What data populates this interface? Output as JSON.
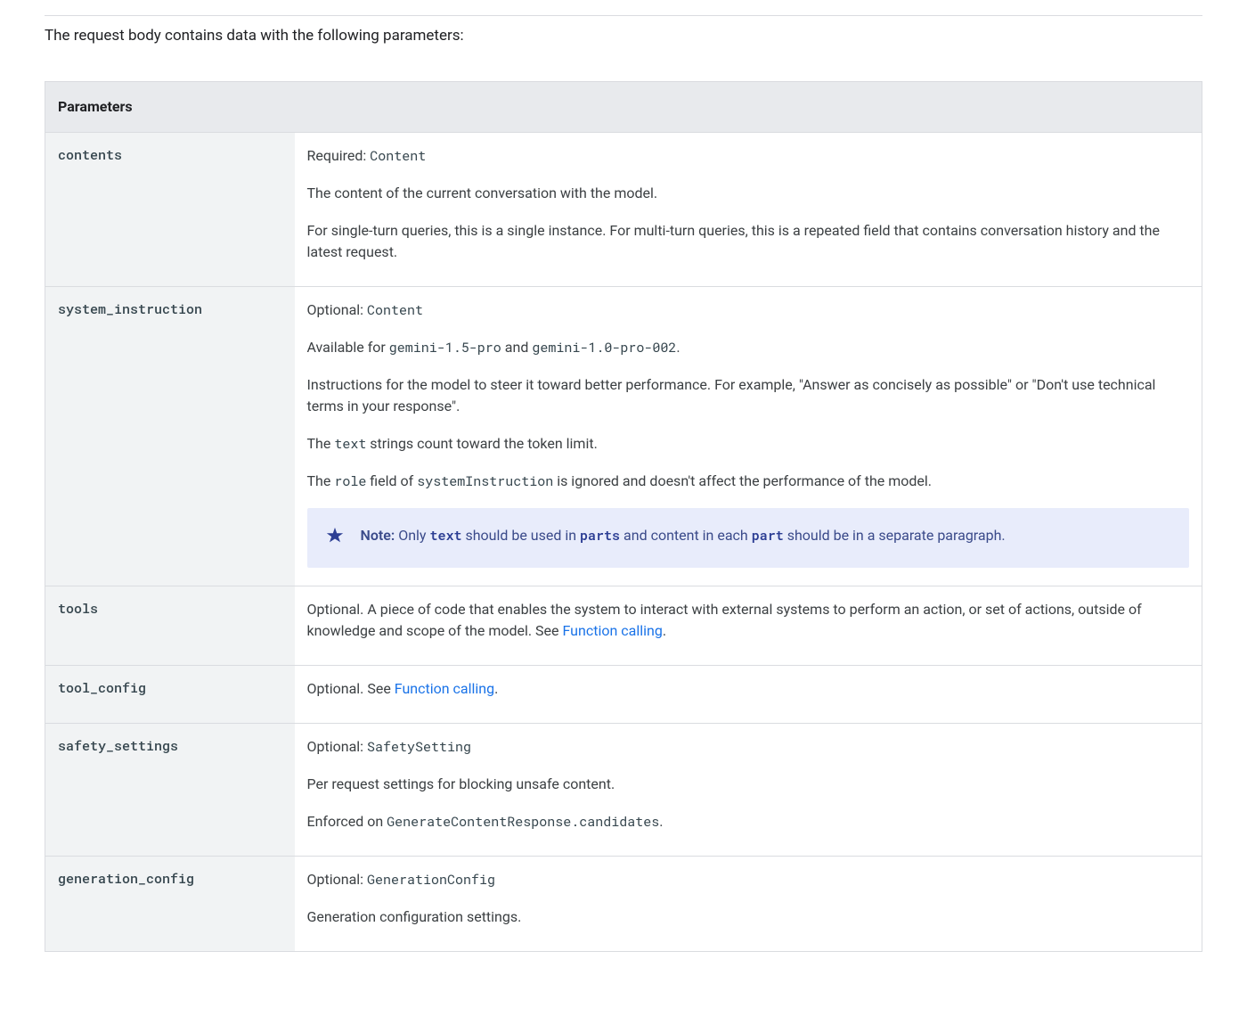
{
  "intro": "The request body contains data with the following parameters:",
  "table": {
    "header": "Parameters",
    "rows": {
      "contents": {
        "name": "contents",
        "req_label": "Required:",
        "req_type": "Content",
        "p1": "The content of the current conversation with the model.",
        "p2": "For single-turn queries, this is a single instance. For multi-turn queries, this is a repeated field that contains conversation history and the latest request."
      },
      "system_instruction": {
        "name": "system_instruction",
        "opt_label": "Optional:",
        "opt_type": "Content",
        "avail_pre": "Available for ",
        "avail_code1": "gemini-1.5-pro",
        "avail_mid": " and ",
        "avail_code2": "gemini-1.0-pro-002",
        "avail_post": ".",
        "p3": "Instructions for the model to steer it toward better performance. For example, \"Answer as concisely as possible\" or \"Don't use technical terms in your response\".",
        "p4_pre": "The ",
        "p4_code": "text",
        "p4_post": " strings count toward the token limit.",
        "p5_pre": "The ",
        "p5_code1": "role",
        "p5_mid": " field of ",
        "p5_code2": "systemInstruction",
        "p5_post": " is ignored and doesn't affect the performance of the model.",
        "note": {
          "label": "Note:",
          "t1": " Only ",
          "c1": "text",
          "t2": " should be used in ",
          "c2": "parts",
          "t3": " and content in each ",
          "c3": "part",
          "t4": " should be in a separate paragraph."
        }
      },
      "tools": {
        "name": "tools",
        "p_pre": "Optional. A piece of code that enables the system to interact with external systems to perform an action, or set of actions, outside of knowledge and scope of the model. See ",
        "link": "Function calling",
        "p_post": "."
      },
      "tool_config": {
        "name": "tool_config",
        "p_pre": "Optional. See ",
        "link": "Function calling",
        "p_post": "."
      },
      "safety_settings": {
        "name": "safety_settings",
        "opt_label": "Optional:",
        "opt_type": "SafetySetting",
        "p1": "Per request settings for blocking unsafe content.",
        "p2_pre": "Enforced on ",
        "p2_code": "GenerateContentResponse.candidates",
        "p2_post": "."
      },
      "generation_config": {
        "name": "generation_config",
        "opt_label": "Optional:",
        "opt_type": "GenerationConfig",
        "p1": "Generation configuration settings."
      }
    }
  }
}
